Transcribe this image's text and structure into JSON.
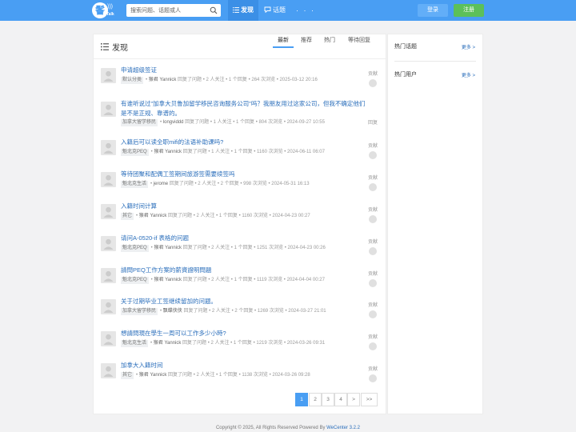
{
  "header": {
    "logo_char": "鬠",
    "logo_text": "Talk",
    "search_placeholder": "搜索问题、话题或人",
    "nav": [
      {
        "label": "发现",
        "icon": "list-icon"
      },
      {
        "label": "话题",
        "icon": "chat-icon"
      },
      {
        "label": "· · ·"
      }
    ],
    "login_label": "登录",
    "register_label": "注册"
  },
  "main": {
    "title": "发现",
    "tabs": [
      "最新",
      "推荐",
      "热门",
      "等待回复"
    ],
    "active_tab": 0,
    "items": [
      {
        "title": "申请超级签证",
        "tag": "默认分类",
        "user": "猴君 Yannick",
        "meta": "回复了问题 • 2 人关注 • 1 个回复 • 264 次浏览 • 2025-03-12 20:16",
        "side": "贡献"
      },
      {
        "title": "有谁听说过\"加拿大贝鲁加留学移民咨询服务公司\"吗？我朋友用过这家公司，但我不确定他们是不是正规、靠谱的。",
        "tag": "加拿大留学移民",
        "user": "longviddd",
        "meta": "回复了问题 • 1 人关注 • 1 个回复 • 804 次浏览 • 2024-09-27 10:55",
        "side": "回复"
      },
      {
        "title": "入籍后可以读全职mifi的法语补助课吗?",
        "tag": "魁北克PEQ",
        "user": "猴君 Yannick",
        "meta": "回复了问题 • 1 人关注 • 1 个回复 • 1160 次浏览 • 2024-06-11 06:07",
        "side": "贡献"
      },
      {
        "title": "等待团聚和配偶工签期间旅游签需要续签吗",
        "tag": "魁北克生活",
        "user": "jerome",
        "meta": "回复了问题 • 2 人关注 • 2 个回复 • 998 次浏览 • 2024-05-31 16:13",
        "side": "贡献"
      },
      {
        "title": "入籍时间计算",
        "tag": "其它",
        "user": "猴君 Yannick",
        "meta": "回复了问题 • 2 人关注 • 1 个回复 • 1160 次浏览 • 2024-04-23 00:27",
        "side": "贡献"
      },
      {
        "title": "请问A-0520-if 表格的问题",
        "tag": "魁北克PEQ",
        "user": "猴君 Yannick",
        "meta": "回复了问题 • 2 人关注 • 1 个回复 • 1251 次浏览 • 2024-04-23 00:26",
        "side": "贡献"
      },
      {
        "title": "請問PEQ工作方案的薪資證明問題",
        "tag": "魁北克PEQ",
        "user": "猴君 Yannick",
        "meta": "回复了问题 • 2 人关注 • 1 个回复 • 1119 次浏览 • 2024-04-04 00:27",
        "side": "贡献"
      },
      {
        "title": "关于过期毕业工签继续留加的问题。",
        "tag": "加拿大留学移民",
        "user": "飘蝶侠侠",
        "meta": "回复了问题 • 2 人关注 • 2 个回复 • 1269 次浏览 • 2024-03-27 21:01",
        "side": "贡献"
      },
      {
        "title": "想請問現在學生一周可以工作多少小時?",
        "tag": "魁北克生活",
        "user": "猴君 Yannick",
        "meta": "回复了问题 • 2 人关注 • 1 个回复 • 1219 次浏览 • 2024-03-26 09:31",
        "side": "贡献"
      },
      {
        "title": "加拿大入籍时间",
        "tag": "其它",
        "user": "猴君 Yannick",
        "meta": "回复了问题 • 2 人关注 • 1 个回复 • 1138 次浏览 • 2024-03-26 09:28",
        "side": "贡献"
      }
    ],
    "pagination": [
      "1",
      "2",
      "3",
      "4",
      ">",
      ">>"
    ],
    "active_page": 0
  },
  "sidebar": {
    "hot_topics": "热门话题",
    "hot_users": "热门用户",
    "more": "更多 >"
  },
  "footer": {
    "text": "Copyright © 2025, All Rights Reserved Powered By ",
    "link": "WeCenter 3.2.2"
  },
  "colors": {
    "brand": "#499ef3",
    "register": "#5cc05a",
    "link": "#2a6ebb"
  }
}
